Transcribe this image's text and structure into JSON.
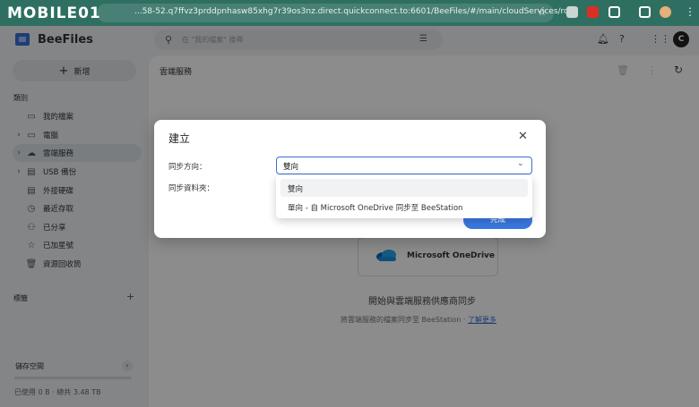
{
  "browser": {
    "logo_text": "MOBILE01",
    "url": "...58-52.q7ffvz3prddpnhasw85xhg7r39os3nz.direct.quickconnect.to:6601/BeeFiles/#/main/cloudServices/root"
  },
  "app": {
    "name": "BeeFiles",
    "search_placeholder": "在 \"我的檔案\" 搜尋",
    "avatar_letter": "C"
  },
  "sidebar": {
    "new_button": "新增",
    "category_title": "類別",
    "items": [
      {
        "label": "我的檔案",
        "icon": "folder-icon",
        "chevron": false
      },
      {
        "label": "電腦",
        "icon": "computer-icon",
        "chevron": true
      },
      {
        "label": "雲端服務",
        "icon": "cloud-icon",
        "chevron": true,
        "active": true
      },
      {
        "label": "USB 備份",
        "icon": "usb-icon",
        "chevron": true
      },
      {
        "label": "外接硬碟",
        "icon": "drive-icon",
        "chevron": false
      },
      {
        "label": "最近存取",
        "icon": "clock-icon",
        "chevron": false
      },
      {
        "label": "已分享",
        "icon": "share-icon",
        "chevron": false
      },
      {
        "label": "已加星號",
        "icon": "star-icon",
        "chevron": false
      },
      {
        "label": "資源回收筒",
        "icon": "trash-icon",
        "chevron": false
      }
    ],
    "tags_title": "標籤",
    "storage_title": "儲存空間",
    "storage_text": "已使用 0 B · 總共 3.48 TB",
    "storage_used_fraction": 0
  },
  "main": {
    "title": "雲端服務",
    "provider_name": "Microsoft OneDrive",
    "message": "開始與雲端服務供應商同步",
    "sub_text": "將雲端服務的檔案同步至 BeeStation · ",
    "learn_more": "了解更多"
  },
  "dialog": {
    "title": "建立",
    "direction_label": "同步方向：",
    "folder_label": "同步資料夾：",
    "direction_value": "雙向",
    "done_button": "完成",
    "options": [
      {
        "label": "雙向",
        "selected": true
      },
      {
        "label": "單向 - 自 Microsoft OneDrive 同步至 BeeStation",
        "selected": false
      }
    ]
  }
}
